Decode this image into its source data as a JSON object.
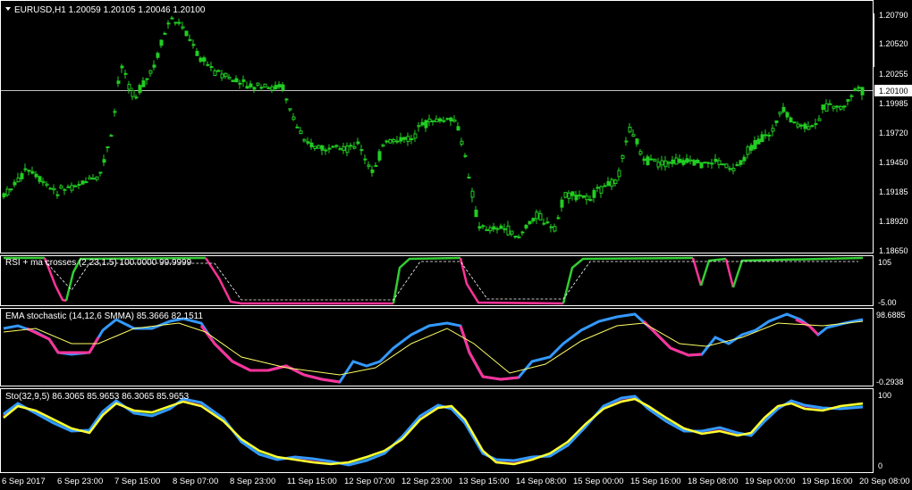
{
  "header": {
    "symbol_line": "EURUSD,H1  1.20059 1.20105 1.20046 1.20100",
    "menu_icon": "triangle-down-icon"
  },
  "price_scale": {
    "ticks": [
      "1.20790",
      "1.20520",
      "1.20255",
      "1.19985",
      "1.19720",
      "1.19450",
      "1.19185",
      "1.18920",
      "1.18650"
    ],
    "current_price": "1.20100"
  },
  "indicators": {
    "rsi": {
      "label": "RSI + ma crosses (2,23,1.5) 100.0000 99.9999",
      "scale_top": "105",
      "scale_bottom": "-5.00"
    },
    "ema_stoch": {
      "label": "EMA stochastic (14,12,6 SMMA) 85.3666 82.1511",
      "scale_top": "98.6885",
      "scale_bottom": "-0.2938"
    },
    "sto": {
      "label": "Sto(32,9,5) 86.3065 85.9653 86.3065 85.9653",
      "scale_top": "100",
      "scale_bottom": "0"
    }
  },
  "time_axis": {
    "labels": [
      "6 Sep 2017",
      "6 Sep 23:00",
      "7 Sep 15:00",
      "8 Sep 07:00",
      "8 Sep 23:00",
      "11 Sep 15:00",
      "12 Sep 07:00",
      "12 Sep 23:00",
      "13 Sep 15:00",
      "14 Sep 08:00",
      "15 Sep 00:00",
      "15 Sep 16:00",
      "18 Sep 08:00",
      "19 Sep 00:00",
      "19 Sep 16:00",
      "20 Sep 08:00"
    ]
  },
  "colors": {
    "candle": "#22cc22",
    "rsi_up": "#33cc33",
    "rsi_down": "#ff3399",
    "ema_up": "#3399ff",
    "ema_down": "#ff3399",
    "signal": "#ffff66",
    "sto_main": "#ffff33",
    "sto_signal": "#3399ff",
    "hist_up": "#33cc33",
    "hist_down": "#ff3399"
  }
}
